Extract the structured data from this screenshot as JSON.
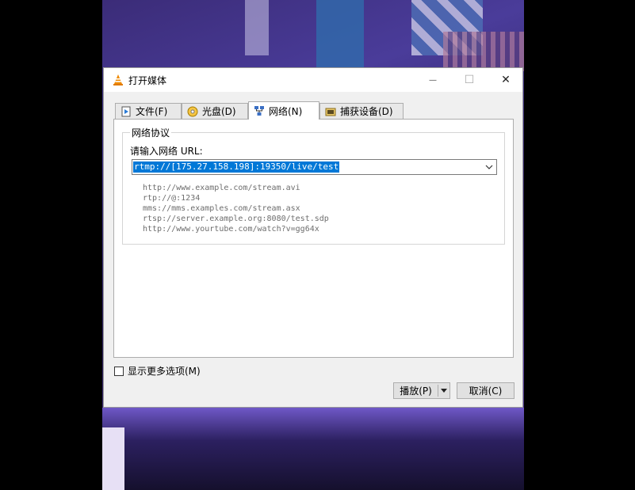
{
  "window": {
    "title": "打开媒体",
    "controls": {
      "minimize": "—",
      "maximize": "☐",
      "close": "✕"
    }
  },
  "tabs": [
    {
      "label": "文件(F)",
      "icon": "file-icon"
    },
    {
      "label": "光盘(D)",
      "icon": "disc-icon"
    },
    {
      "label": "网络(N)",
      "icon": "network-icon",
      "active": true
    },
    {
      "label": "捕获设备(D)",
      "icon": "capture-device-icon"
    }
  ],
  "network": {
    "group_title": "网络协议",
    "url_label": "请输入网络 URL:",
    "url_value": "rtmp://[175.27.158.198]:19350/live/test",
    "examples": [
      "http://www.example.com/stream.avi",
      "rtp://@:1234",
      "mms://mms.examples.com/stream.asx",
      "rtsp://server.example.org:8080/test.sdp",
      "http://www.yourtube.com/watch?v=gg64x"
    ]
  },
  "options": {
    "more_label": "显示更多选项(M)",
    "checked": false
  },
  "buttons": {
    "play": "播放(P)",
    "cancel": "取消(C)"
  },
  "colors": {
    "selection": "#0078d7",
    "dialog_bg": "#f0f0f0"
  }
}
